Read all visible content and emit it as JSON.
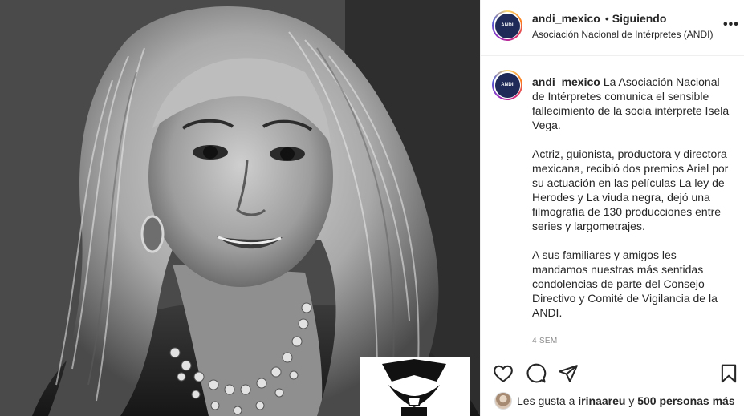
{
  "post": {
    "username": "andi_mexico",
    "separator": "•",
    "follow_status": "Siguiendo",
    "location": "Asociación Nacional de Intérpretes (ANDI)",
    "more_label": "•••",
    "avatar_text": "ANDI",
    "caption_paragraphs": [
      "La Asociación Nacional de Intérpretes comunica el sensible fallecimiento de la socia intérprete Isela Vega.",
      "Actriz, guionista, productora y directora mexicana, recibió dos premios Ariel por su actuación en las películas La ley de Herodes y La viuda negra, dejó una filmografía de 130 producciones entre series y largometrajes.",
      "A sus familiares y amigos les mandamos nuestras más sentidas condolencias de parte del Consejo Directivo y Comité de Vigilancia de la ANDI."
    ],
    "timestamp": "4 sem"
  },
  "likes": {
    "prefix": "Les gusta a",
    "first_user": "irinaareu",
    "connector": "y",
    "others": "500 personas más"
  },
  "icons": {
    "like": "heart-icon",
    "comment": "comment-icon",
    "share": "paper-plane-icon",
    "save": "bookmark-icon",
    "options": "more-options-icon"
  }
}
